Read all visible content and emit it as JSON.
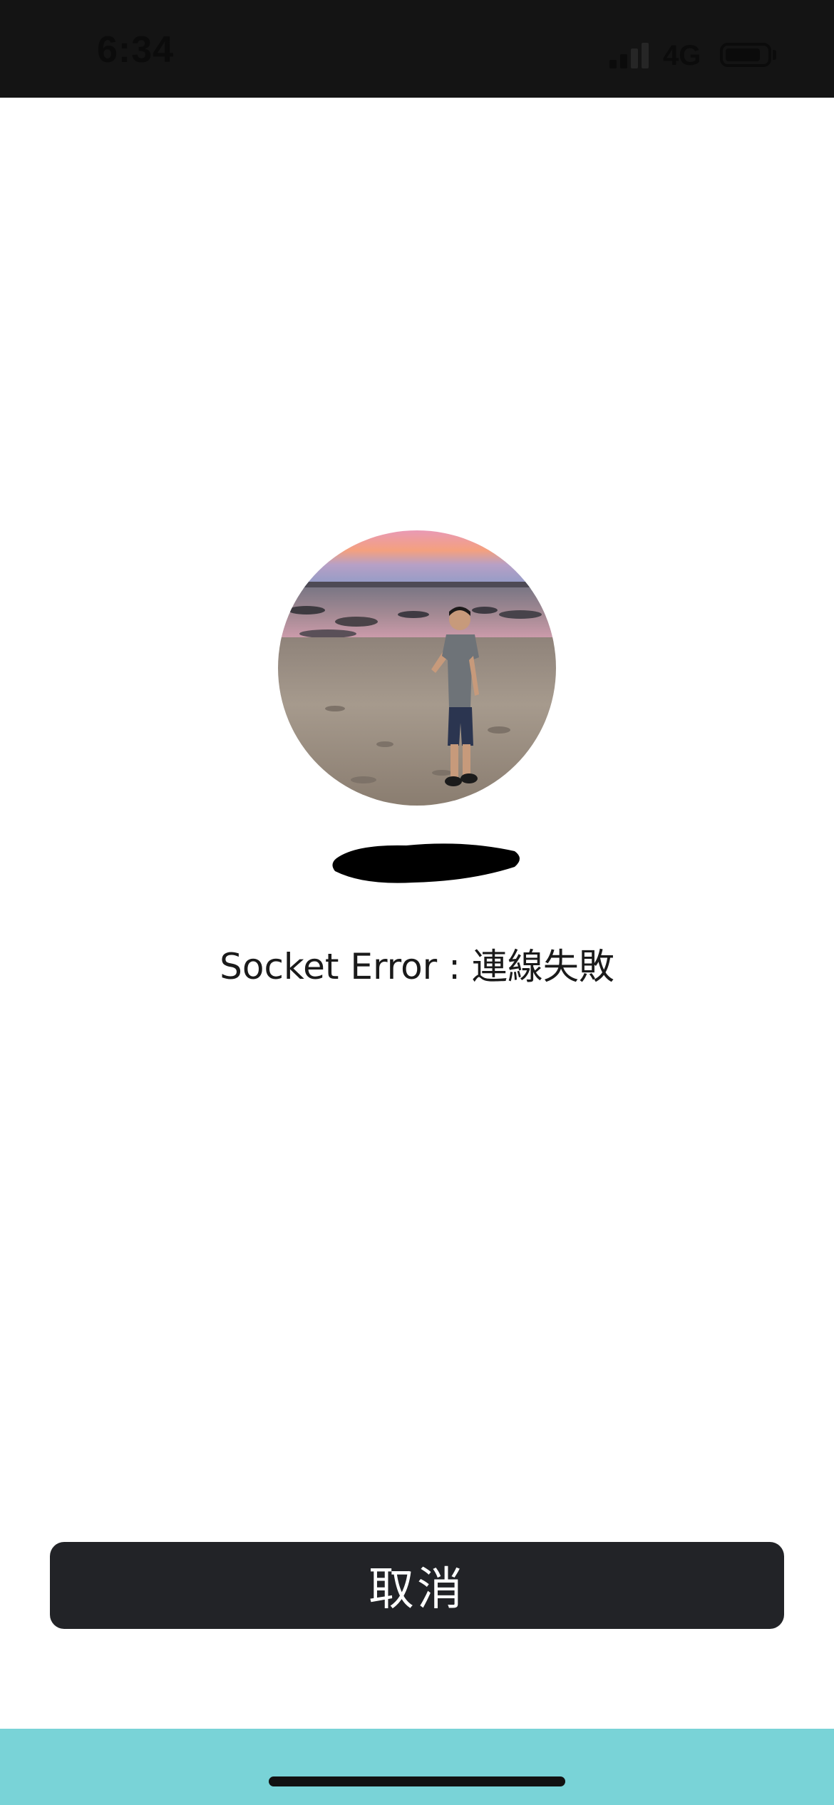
{
  "status_bar": {
    "time": "6:34",
    "network": "4G",
    "icons": [
      "signal-icon",
      "battery-icon"
    ]
  },
  "call": {
    "error_message": "Socket Error : 連線失敗",
    "cancel_label": "取消"
  },
  "colors": {
    "status_bar_bg": "#141414",
    "button_bg": "#222327",
    "bottom_bar_bg": "#79d3d7"
  }
}
